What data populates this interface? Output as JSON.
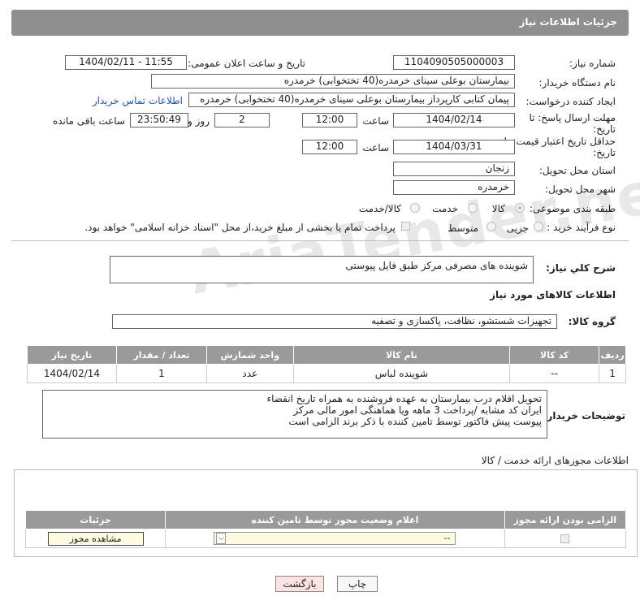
{
  "header": {
    "title": "جزئیات اطلاعات نیاز"
  },
  "form": {
    "need_number_label": "شماره نیاز:",
    "need_number": "1104090505000003",
    "announce_label": "تاریخ و ساعت اعلان عمومی:",
    "announce_value": "1404/02/11 - 11:55",
    "buyer_org_label": "نام دستگاه خریدار:",
    "buyer_org": "بیمارستان بوعلی سینای خرمدره(40 تختخوابی) خرمدره",
    "creator_label": "ایجاد کننده درخواست:",
    "creator": "پیمان کتابی کارپرداز بیمارستان بوعلی سینای خرمدره(40 تختخوابی) خرمدره",
    "contact_link": "اطلاعات تماس خریدار",
    "reply_deadline_label": "مهلت ارسال پاسخ: تا تاریخ:",
    "reply_date": "1404/02/14",
    "time_label": "ساعت",
    "reply_time": "12:00",
    "days_value": "2",
    "days_label": "روز و",
    "remaining_time": "23:50:49",
    "remaining_label": "ساعت باقی مانده",
    "price_deadline_label": "حداقل تاریخ اعتبار قیمت: تا تاریخ:",
    "price_date": "1404/03/31",
    "price_time": "12:00",
    "province_label": "استان محل تحویل:",
    "province": "زنجان",
    "city_label": "شهر محل تحویل:",
    "city": "خرمدره",
    "category_label": "طبقه بندی موضوعی:",
    "category_options": [
      "کالا",
      "خدمت",
      "کالا/خدمت"
    ],
    "process_label": "نوع فرآیند خرید :",
    "process_options": [
      "جزیی",
      "متوسط"
    ],
    "payment_note": "پرداخت تمام یا بخشی از مبلغ خرید،از محل \"اسناد خزانه اسلامی\" خواهد بود."
  },
  "description": {
    "label": "شرح کلي نياز:",
    "value": "شوینده های مصرفی مرکز طبق فایل پیوستی"
  },
  "goods": {
    "section_title": "اطلاعات کالاهای مورد نیاز",
    "group_label": "گروه کالا:",
    "group_value": "تجهیزات شستشو، نظافت، پاکسازی و تصفیه",
    "columns": [
      "ردیف",
      "کد کالا",
      "نام کالا",
      "واحد شمارش",
      "تعداد / مقدار",
      "تاریخ نیاز"
    ],
    "rows": [
      [
        "1",
        "--",
        "شوینده لباس",
        "عدد",
        "1",
        "1404/02/14"
      ]
    ],
    "buyer_notes_label": "توضیحات خریدار:",
    "buyer_notes": [
      "تحویل اقلام درب بیمارستان به عهده فروشنده به همراه تاریخ انقضاء",
      "ایران کد مشابه /پرداخت 3 ماهه ویا هماهنگی امور مالی مرکز",
      "پیوست پیش فاکتور توسط تامین کننده با ذکر برند الزامی است"
    ]
  },
  "permits": {
    "section_title": "اطلاعات مجوزهای ارائه خدمت / کالا",
    "columns": [
      "الزامی بودن ارائه مجوز",
      "اعلام وضعیت مجوز توسط تامین کننده",
      "جزئیات"
    ],
    "select_value": "--",
    "view_button": "مشاهده مجوز"
  },
  "buttons": {
    "print": "چاپ",
    "back": "بازگشت"
  },
  "watermark": "AriaTender.neT"
}
